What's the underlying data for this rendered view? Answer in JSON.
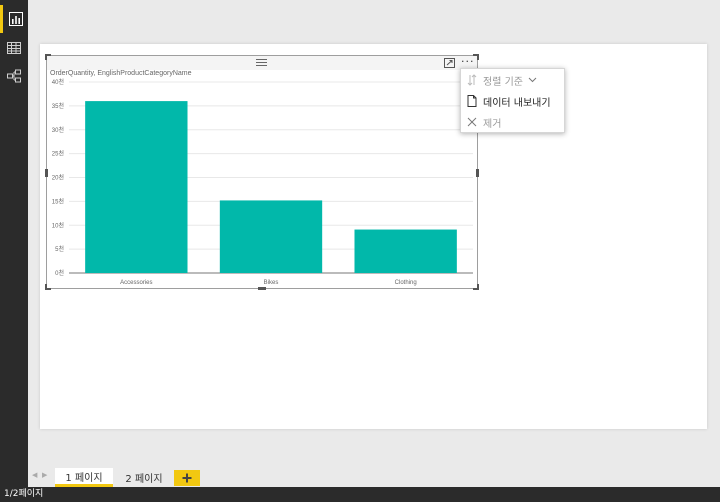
{
  "rail": {
    "items": [
      {
        "icon": "report-icon",
        "active": true
      },
      {
        "icon": "data-icon",
        "active": false
      },
      {
        "icon": "relationships-icon",
        "active": false
      }
    ]
  },
  "visual": {
    "title": "OrderQuantity, EnglishProductCategoryName"
  },
  "chart_data": {
    "type": "bar",
    "title": "OrderQuantity, EnglishProductCategoryName",
    "categories": [
      "Accessories",
      "Bikes",
      "Clothing"
    ],
    "values": [
      36000,
      15200,
      9100
    ],
    "ylim": [
      0,
      40000
    ],
    "yticks": [
      0,
      5000,
      10000,
      15000,
      20000,
      25000,
      30000,
      35000,
      40000
    ],
    "ytick_labels": [
      "0천",
      "5천",
      "10천",
      "15천",
      "20천",
      "25천",
      "30천",
      "35천",
      "40천"
    ],
    "grid": true,
    "color": "#01b8aa"
  },
  "menu": {
    "items": [
      {
        "label": "정렬 기준",
        "icon": "sort-icon",
        "disabled": true
      },
      {
        "label": "데이터 내보내기",
        "icon": "export-icon",
        "disabled": false
      },
      {
        "label": "제거",
        "icon": "close-icon",
        "disabled": true
      }
    ]
  },
  "tabs": [
    {
      "label": "1 페이지",
      "active": true
    },
    {
      "label": "2 페이지",
      "active": false
    }
  ],
  "status": {
    "text": "1/2페이지"
  },
  "colors": {
    "accent": "#f2c811",
    "bar": "#01b8aa",
    "rail": "#2b2b2b"
  }
}
